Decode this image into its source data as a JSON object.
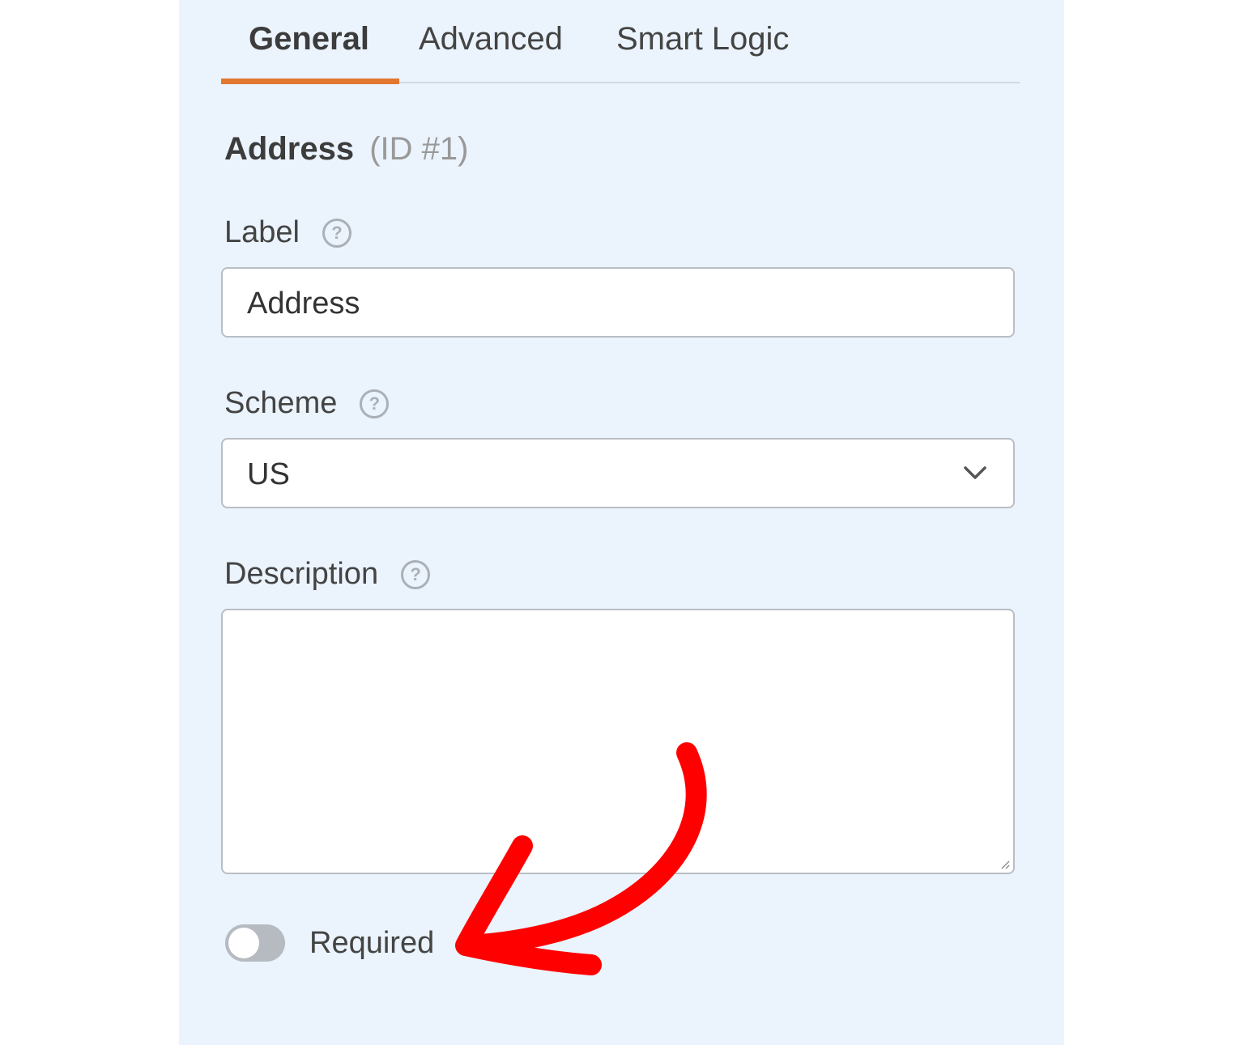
{
  "tabs": [
    {
      "label": "General",
      "active": true
    },
    {
      "label": "Advanced",
      "active": false
    },
    {
      "label": "Smart Logic",
      "active": false
    }
  ],
  "field": {
    "name": "Address",
    "id_text": "(ID #1)"
  },
  "label_field": {
    "label": "Label",
    "value": "Address"
  },
  "scheme_field": {
    "label": "Scheme",
    "selected": "US"
  },
  "description_field": {
    "label": "Description",
    "value": ""
  },
  "required_toggle": {
    "label": "Required",
    "on": false
  },
  "colors": {
    "panel_bg": "#ebf3fc",
    "tab_accent": "#e27730",
    "annotation_arrow": "#ff0000"
  },
  "icons": {
    "help": "question-circle-icon",
    "select": "chevron-down-icon"
  }
}
